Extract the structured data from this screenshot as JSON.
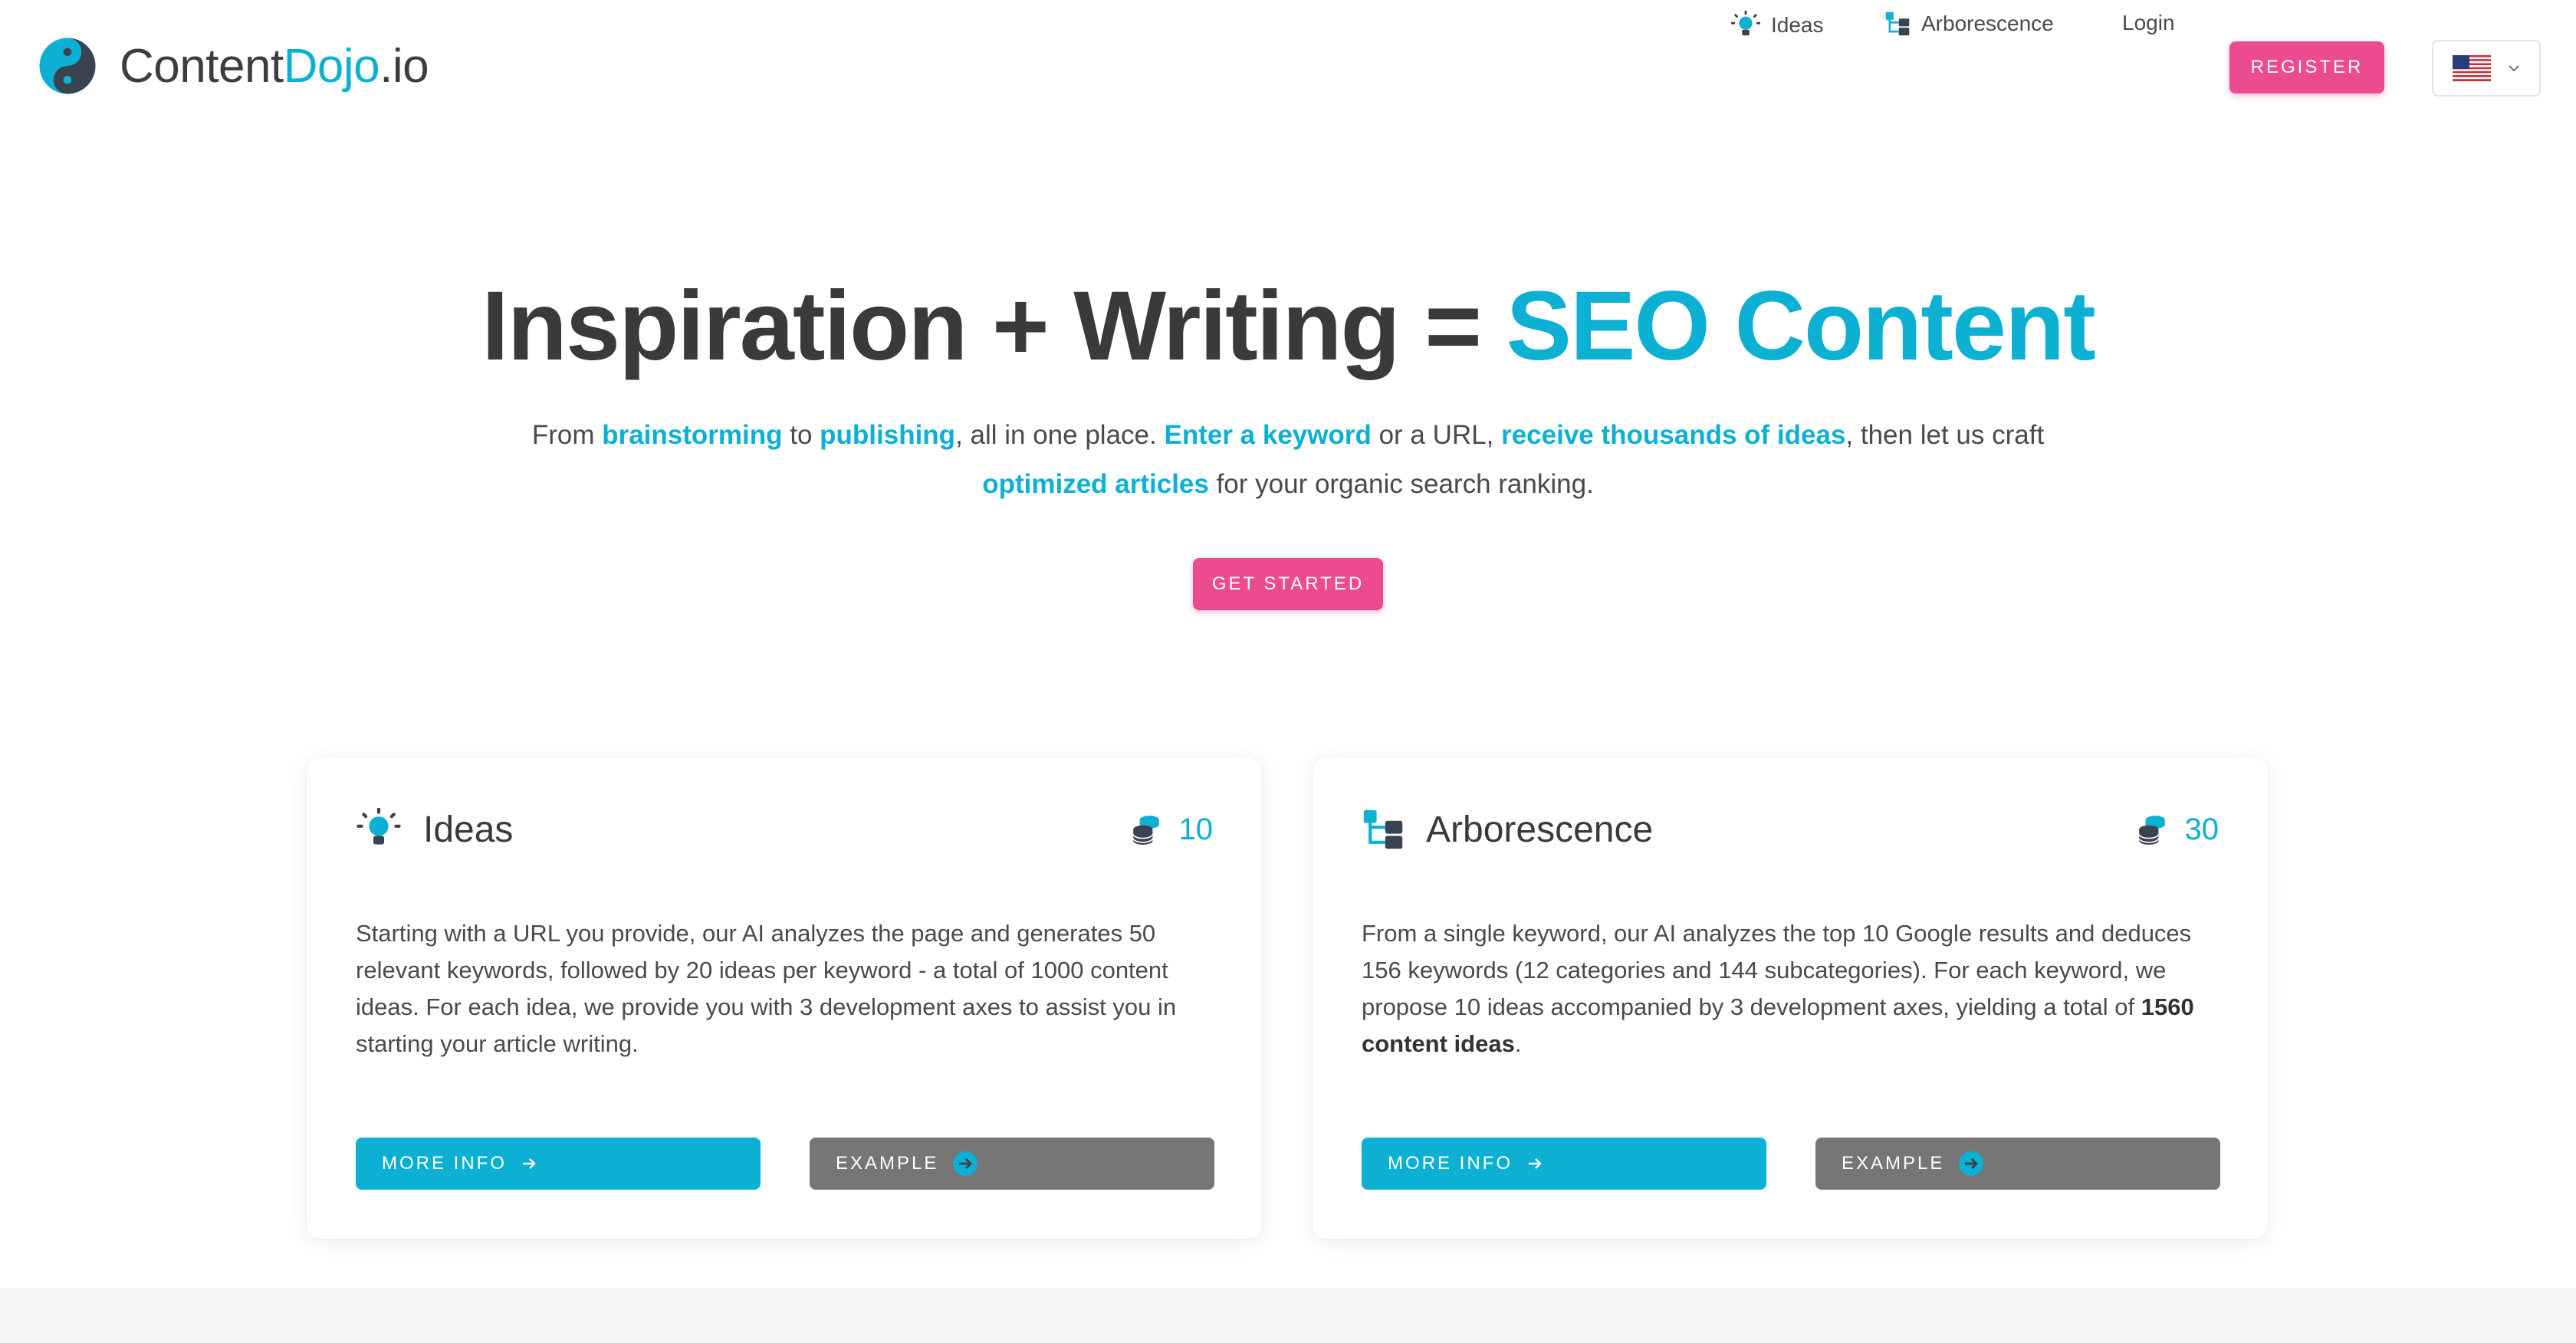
{
  "brand": {
    "name_part1": "Content",
    "name_part2": "Dojo",
    "name_part3": ".io",
    "logo_icon": "yin-yang-icon",
    "accent_color": "#0cb0d3",
    "cta_color": "#ec4c8f"
  },
  "nav": {
    "ideas_label": "Ideas",
    "ideas_icon": "lightbulb-icon",
    "arborescence_label": "Arborescence",
    "arborescence_icon": "tree-structure-icon",
    "login_label": "Login",
    "register_label": "REGISTER",
    "language_icon": "us-flag-icon"
  },
  "hero": {
    "title_part1": "Inspiration + Writing = ",
    "title_part2": "SEO Content",
    "sub": {
      "t1": "From ",
      "h1": "brainstorming",
      "t2": " to ",
      "h2": "publishing",
      "t3": ", all in one place. ",
      "h3": "Enter a keyword",
      "t4": " or a URL, ",
      "h4": "receive thousands of ideas",
      "t5": ", then let us craft ",
      "h5": "optimized articles",
      "t6": " for your organic search ranking."
    },
    "cta_label": "GET STARTED"
  },
  "cards": [
    {
      "title": "Ideas",
      "icon": "lightbulb-icon",
      "cost_icon": "coins-icon",
      "cost": "10",
      "desc": "Starting with a URL you provide, our AI analyzes the page and generates 50 relevant keywords, followed by 20 ideas per keyword - a total of 1000 content ideas. For each idea, we provide you with 3 development axes to assist you in starting your article writing.",
      "more_label": "MORE INFO",
      "example_label": "EXAMPLE"
    },
    {
      "title": "Arborescence",
      "icon": "tree-structure-icon",
      "cost_icon": "coins-icon",
      "cost": "30",
      "desc_part1": "From a single keyword, our AI analyzes the top 10 Google results and deduces 156 keywords (12 categories and 144 subcategories). For each keyword, we propose 10 ideas accompanied by 3 development axes, yielding a total of ",
      "desc_bold": "1560 content ideas",
      "desc_part2": ".",
      "more_label": "MORE INFO",
      "example_label": "EXAMPLE"
    }
  ]
}
